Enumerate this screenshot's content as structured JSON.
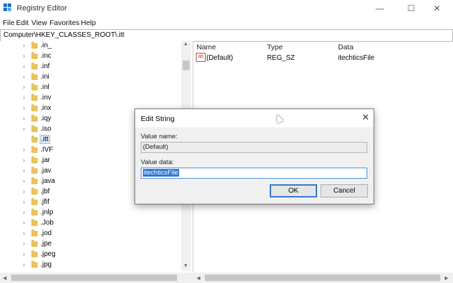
{
  "window": {
    "title": "Registry Editor",
    "minimize": "—",
    "maximize": "☐",
    "close": "✕"
  },
  "menu": [
    "File",
    "Edit",
    "View",
    "Favorites",
    "Help"
  ],
  "address": "Computer\\HKEY_CLASSES_ROOT\\.itt",
  "tree": [
    {
      "label": ".in_",
      "chevron": "›"
    },
    {
      "label": ".inc",
      "chevron": "›"
    },
    {
      "label": ".inf",
      "chevron": "›"
    },
    {
      "label": ".ini",
      "chevron": "›"
    },
    {
      "label": ".inl",
      "chevron": "›"
    },
    {
      "label": ".inv",
      "chevron": "›"
    },
    {
      "label": ".inx",
      "chevron": "›"
    },
    {
      "label": ".iqy",
      "chevron": "›"
    },
    {
      "label": ".iso",
      "chevron": "›"
    },
    {
      "label": ".itt",
      "chevron": "",
      "selected": true
    },
    {
      "label": ".IVF",
      "chevron": "›"
    },
    {
      "label": ".jar",
      "chevron": "›"
    },
    {
      "label": ".jav",
      "chevron": "›"
    },
    {
      "label": ".java",
      "chevron": "›"
    },
    {
      "label": ".jbf",
      "chevron": "›"
    },
    {
      "label": ".jfif",
      "chevron": "›"
    },
    {
      "label": ".jnlp",
      "chevron": "›"
    },
    {
      "label": ".Job",
      "chevron": "›"
    },
    {
      "label": ".jod",
      "chevron": "›"
    },
    {
      "label": ".jpe",
      "chevron": "›"
    },
    {
      "label": ".jpeg",
      "chevron": "›"
    },
    {
      "label": ".jpg",
      "chevron": "›"
    }
  ],
  "values": {
    "headers": {
      "name": "Name",
      "type": "Type",
      "data": "Data"
    },
    "icon_text": "ab",
    "rows": [
      {
        "name": "(Default)",
        "type": "REG_SZ",
        "data": "itechticsFile"
      }
    ]
  },
  "dialog": {
    "title": "Edit String",
    "close": "✕",
    "value_name_label": "Value name:",
    "value_name": "(Default)",
    "value_data_label": "Value data:",
    "value_data": "itechticsFile",
    "ok": "OK",
    "cancel": "Cancel"
  },
  "scroll_arrows": {
    "up": "▲",
    "down": "▼",
    "left": "◀",
    "right": "▶"
  }
}
